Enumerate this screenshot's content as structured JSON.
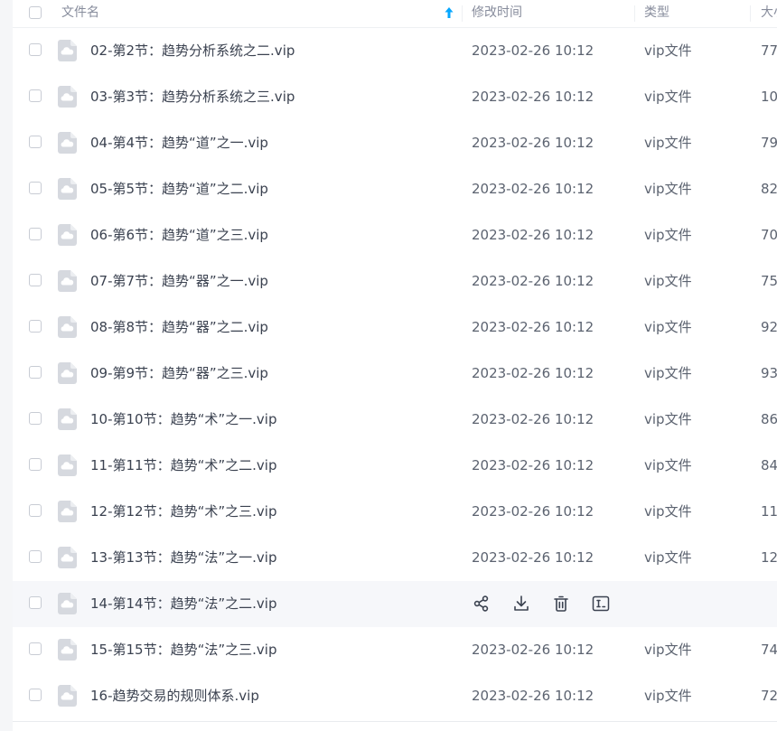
{
  "header": {
    "name_label": "文件名",
    "time_label": "修改时间",
    "type_label": "类型",
    "size_label": "大小"
  },
  "files": [
    {
      "name": "02-第2节：趋势分析系统之二.vip",
      "time": "2023-02-26 10:12",
      "type": "vip文件",
      "size": "77"
    },
    {
      "name": "03-第3节：趋势分析系统之三.vip",
      "time": "2023-02-26 10:12",
      "type": "vip文件",
      "size": "10"
    },
    {
      "name": "04-第4节：趋势“道”之一.vip",
      "time": "2023-02-26 10:12",
      "type": "vip文件",
      "size": "79"
    },
    {
      "name": "05-第5节：趋势“道”之二.vip",
      "time": "2023-02-26 10:12",
      "type": "vip文件",
      "size": "82"
    },
    {
      "name": "06-第6节：趋势“道”之三.vip",
      "time": "2023-02-26 10:12",
      "type": "vip文件",
      "size": "70"
    },
    {
      "name": "07-第7节：趋势“器”之一.vip",
      "time": "2023-02-26 10:12",
      "type": "vip文件",
      "size": "75"
    },
    {
      "name": "08-第8节：趋势“器”之二.vip",
      "time": "2023-02-26 10:12",
      "type": "vip文件",
      "size": "92"
    },
    {
      "name": "09-第9节：趋势“器”之三.vip",
      "time": "2023-02-26 10:12",
      "type": "vip文件",
      "size": "93"
    },
    {
      "name": "10-第10节：趋势“术”之一.vip",
      "time": "2023-02-26 10:12",
      "type": "vip文件",
      "size": "86"
    },
    {
      "name": "11-第11节：趋势“术”之二.vip",
      "time": "2023-02-26 10:12",
      "type": "vip文件",
      "size": "84"
    },
    {
      "name": "12-第12节：趋势“术”之三.vip",
      "time": "2023-02-26 10:12",
      "type": "vip文件",
      "size": "11"
    },
    {
      "name": "13-第13节：趋势“法”之一.vip",
      "time": "2023-02-26 10:12",
      "type": "vip文件",
      "size": "12"
    },
    {
      "name": "14-第14节：趋势“法”之二.vip",
      "time": "",
      "type": "",
      "size": "",
      "hover": true
    },
    {
      "name": "15-第15节：趋势“法”之三.vip",
      "time": "2023-02-26 10:12",
      "type": "vip文件",
      "size": "74"
    },
    {
      "name": "16-趋势交易的规则体系.vip",
      "time": "2023-02-26 10:12",
      "type": "vip文件",
      "size": "72"
    }
  ],
  "row_actions": [
    "share-icon",
    "download-icon",
    "delete-icon",
    "rename-icon"
  ],
  "colors": {
    "accent": "#06a7ff",
    "hover_row": "#f6f7fa",
    "file_icon": "#d6d9df"
  }
}
